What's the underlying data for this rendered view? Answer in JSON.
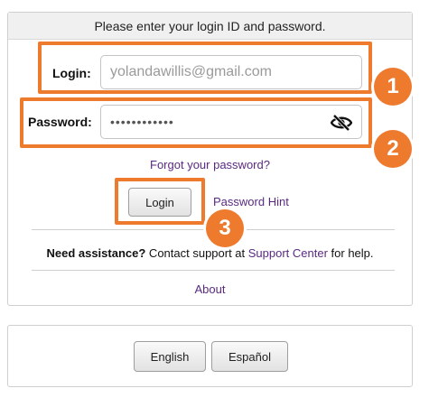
{
  "header": {
    "text": "Please enter your login ID and password."
  },
  "login": {
    "label": "Login:",
    "placeholder": "yolandawillis@gmail.com"
  },
  "password": {
    "label": "Password:",
    "value": "••••••••••••",
    "toggle_icon": "eye-slash-icon"
  },
  "links": {
    "forgot": "Forgot your password?",
    "hint": "Password Hint",
    "about": "About"
  },
  "buttons": {
    "login": "Login"
  },
  "assistance": {
    "bold": "Need assistance?",
    "pre": " Contact support at ",
    "link": "Support Center",
    "post": " for help."
  },
  "languages": [
    "English",
    "Español"
  ],
  "callouts": [
    "1",
    "2",
    "3"
  ],
  "colors": {
    "accent": "#ee7a2e",
    "link": "#5a2a82"
  }
}
